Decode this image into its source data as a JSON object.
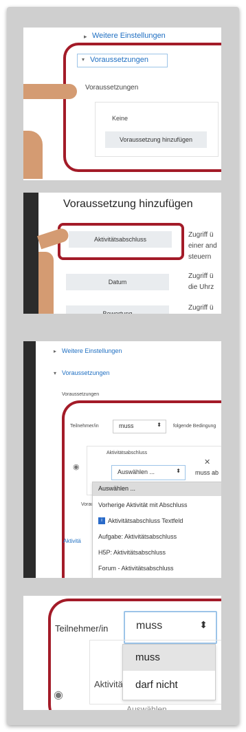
{
  "panel1": {
    "more_settings": "Weitere Einstellungen",
    "section": "Voraussetzungen",
    "subheading": "Voraussetzungen",
    "none": "Keine",
    "add_button": "Voraussetzung hinzufügen"
  },
  "panel2": {
    "title": "Voraussetzung hinzufügen",
    "options": [
      {
        "label": "Aktivitätsabschluss",
        "desc": "Zugriff ü\neiner and\nsteuern"
      },
      {
        "label": "Datum",
        "desc": "Zugriff ü\ndie Uhrz"
      },
      {
        "label": "Bewertung",
        "desc": "Zugriff ü\nBewertu"
      }
    ]
  },
  "panel3": {
    "more_settings": "Weitere Einstellungen",
    "section": "Voraussetzungen",
    "subheading": "Voraussetzungen",
    "participant_label": "Teilnehmer/in",
    "must_value": "muss",
    "following": "folgende Bedingung",
    "condition_type": "Aktivitätsabschluss",
    "select_value": "Auswählen ...",
    "must_short": "muss ab",
    "vorau": "Vorau",
    "aktivitat": "Aktivitä",
    "dropdown": [
      "Auswählen ...",
      "Vorherige Aktivität mit Abschluss",
      "Aktivitätsabschluss Textfeld",
      "Aufgabe: Aktivitätsabschluss",
      "H5P: Aktivitätsabschluss",
      "Forum - Aktivitätsabschluss"
    ]
  },
  "panel4": {
    "participant_label": "Teilnehmer/in",
    "select_value": "muss",
    "options": [
      "muss",
      "darf nicht"
    ],
    "aktivitat": "Aktivitä",
    "auswahlen": "Auswählen"
  },
  "colors": {
    "accent_red": "#a31b28",
    "link_blue": "#1f6fc2",
    "skin": "#d49b72"
  }
}
